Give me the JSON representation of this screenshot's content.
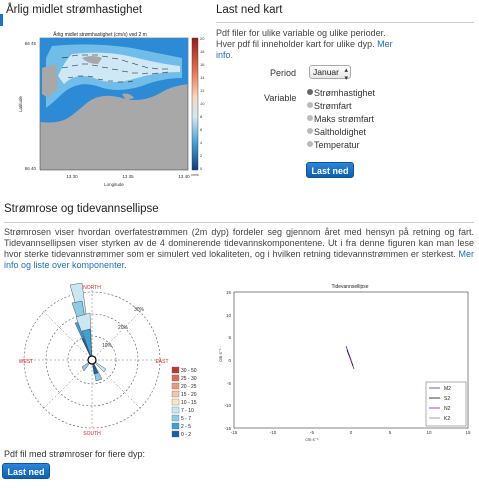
{
  "section1": {
    "title": "Årlig midlet strømhastighet"
  },
  "map": {
    "title": "Årlig midlet strømhastighet (cm/s) ved 2 m",
    "ylabel": "Latitude",
    "xlabel": "Longitude",
    "y_ticks": [
      "66 45",
      "66 40"
    ],
    "x_ticks": [
      "13 30",
      "13 35",
      "13 40"
    ],
    "colorbar_ticks": [
      "20",
      "18",
      "16",
      "14",
      "12",
      "10",
      "8",
      "6",
      "4",
      "2",
      "0"
    ],
    "colorbar_label": "cm/s"
  },
  "download_map": {
    "title": "Last ned kart",
    "description": "Pdf filer for ulike variable og ulike perioder. Hver pdf fil inneholder kart for ulike dyp.",
    "more_info": "Mer info.",
    "period_label": "Period",
    "period_value": "Januar",
    "variable_label": "Variable",
    "variables": [
      {
        "label": "Strømhastighet",
        "selected": true
      },
      {
        "label": "Strømfart",
        "selected": false
      },
      {
        "label": "Maks strømfart",
        "selected": false
      },
      {
        "label": "Saltholdighet",
        "selected": false
      },
      {
        "label": "Temperatur",
        "selected": false
      }
    ],
    "button": "Last ned"
  },
  "section2": {
    "title": "Strømrose og tidevannsellipse",
    "paragraph": "Strømrosen viser hvordan overfatestrømmen (2m dyp) fordeler seg gjennom året med hensyn på retning og fart. Tidevannsellipsen viser styrken av de 4 dominerende tidevannskomponentene. Ut i fra denne figuren kan man lese hvor sterke tidevannstrømmer som er simulert ved lokaliteten, og i hvilken retning tidevannstrømmen er sterkest.",
    "more_info": "Mer info og liste over komponenter."
  },
  "rose": {
    "directions": {
      "north": "NORTH",
      "south": "SOUTH",
      "east": "EAST",
      "west": "WEST"
    },
    "rings": [
      "10%",
      "20%",
      "30%"
    ],
    "legend": [
      {
        "label": "30 - 50",
        "color": "#c0392b"
      },
      {
        "label": "25 - 30",
        "color": "#e06a5a"
      },
      {
        "label": "20 - 25",
        "color": "#ec9a7e"
      },
      {
        "label": "15 - 20",
        "color": "#f2c5a5"
      },
      {
        "label": "10 - 15",
        "color": "#f6e6c6"
      },
      {
        "label": "7 - 10",
        "color": "#cbe7f2"
      },
      {
        "label": "5 - 7",
        "color": "#8dcbe8"
      },
      {
        "label": "2 - 5",
        "color": "#3fa0d6"
      },
      {
        "label": "0 - 2",
        "color": "#1463a8"
      }
    ]
  },
  "ellipse": {
    "title": "Tidevannsellipse",
    "ylabel": "cm s⁻¹",
    "xlabel": "cm s⁻¹",
    "x_ticks": [
      "-15",
      "-10",
      "-5",
      "0",
      "5",
      "10",
      "15"
    ],
    "y_ticks": [
      "15",
      "10",
      "5",
      "0",
      "-5",
      "-10",
      "-15"
    ],
    "legend": [
      {
        "label": "M2",
        "color": "#2b3bd6"
      },
      {
        "label": "S2",
        "color": "#111111"
      },
      {
        "label": "N2",
        "color": "#7a2ab8"
      },
      {
        "label": "K2",
        "color": "#888888"
      }
    ]
  },
  "download_rose": {
    "label": "Pdf fil med strømroser for fiere dyp:",
    "button": "Last ned"
  }
}
